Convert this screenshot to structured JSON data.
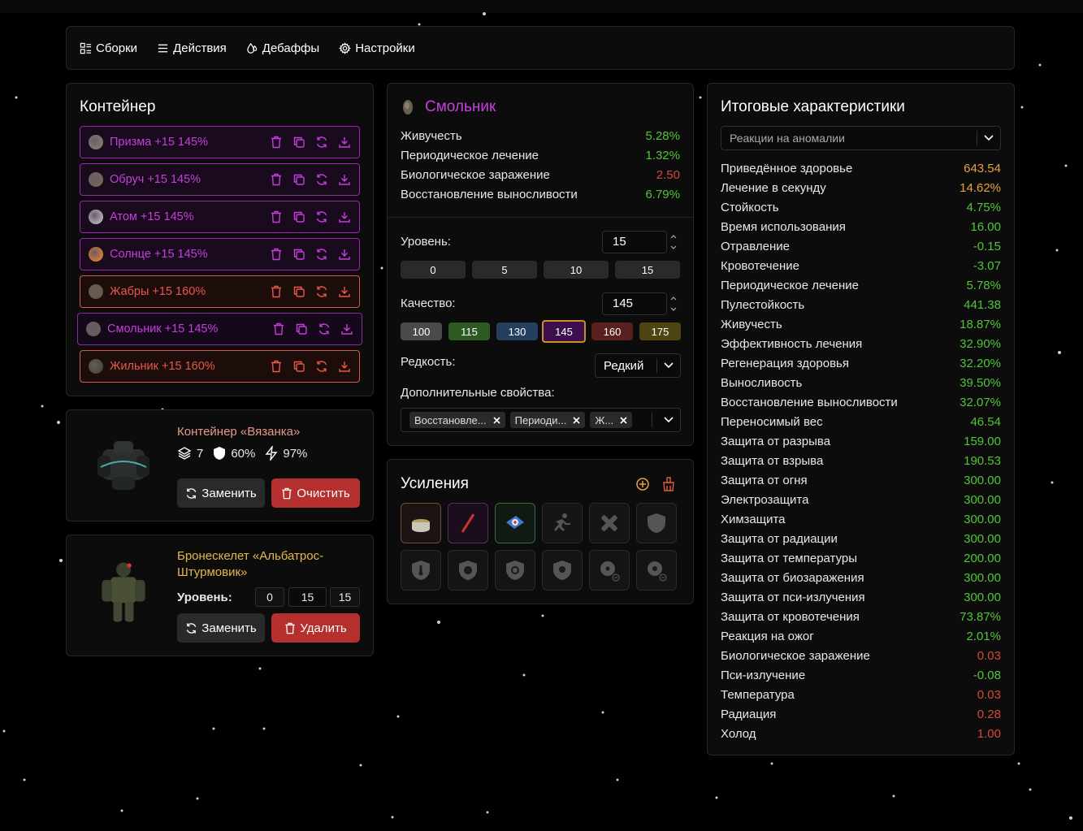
{
  "colors": {
    "green": "#52c43a",
    "orange": "#e8a23c",
    "red": "#d24a3c",
    "purple": "#c43fdc",
    "gold": "#e8b84a"
  },
  "nav": [
    {
      "label": "Сборки",
      "icon": "builds-icon"
    },
    {
      "label": "Действия",
      "icon": "list-icon"
    },
    {
      "label": "Дебаффы",
      "icon": "drops-icon"
    },
    {
      "label": "Настройки",
      "icon": "gear-icon"
    }
  ],
  "container": {
    "title": "Контейнер",
    "artifacts": [
      {
        "name": "Призма +15 145%",
        "tone": "purple",
        "color": "#8a8c6a"
      },
      {
        "name": "Обруч +15 145%",
        "tone": "purple",
        "color": "#7a6a50"
      },
      {
        "name": "Атом +15 145%",
        "tone": "purple",
        "color": "#cfcfcf"
      },
      {
        "name": "Солнце +15 145%",
        "tone": "purple",
        "color": "#ff8a1a"
      },
      {
        "name": "Жабры +15 160%",
        "tone": "red",
        "color": "#6a5440"
      },
      {
        "name": "Смольник +15 145%",
        "tone": "purple",
        "color": "#6a6050",
        "selected": true
      },
      {
        "name": "Жильник +15 160%",
        "tone": "red",
        "color": "#3a4030"
      }
    ]
  },
  "container_card": {
    "title": "Контейнер «Вязанка»",
    "slots": "7",
    "protection": "60%",
    "efficiency": "97%",
    "replace_label": "Заменить",
    "clear_label": "Очистить"
  },
  "armor_card": {
    "title_line1": "Бронескелет «Альбатрос-",
    "title_line2": "Штурмовик»",
    "level_label": "Уровень:",
    "levels": [
      "0",
      "15",
      "15"
    ],
    "replace_label": "Заменить",
    "delete_label": "Удалить"
  },
  "artifact": {
    "name": "Смольник",
    "stats": [
      {
        "label": "Живучесть",
        "value": "5.28%",
        "tone": "g"
      },
      {
        "label": "Периодическое лечение",
        "value": "1.32%",
        "tone": "g"
      },
      {
        "label": "Биологическое заражение",
        "value": "2.50",
        "tone": "r"
      },
      {
        "label": "Восстановление выносливости",
        "value": "6.79%",
        "tone": "g"
      }
    ],
    "level_label": "Уровень:",
    "level_value": "15",
    "level_presets": [
      "0",
      "5",
      "10",
      "15"
    ],
    "quality_label": "Качество:",
    "quality_value": "145",
    "quality_presets": [
      {
        "v": "100",
        "bg": "#4a4a4a"
      },
      {
        "v": "115",
        "bg": "#2d5a23"
      },
      {
        "v": "130",
        "bg": "#24405e"
      },
      {
        "v": "145",
        "bg": "#3e0f4e"
      },
      {
        "v": "160",
        "bg": "#5a1f1f"
      },
      {
        "v": "175",
        "bg": "#4e4414"
      }
    ],
    "rarity_label": "Редкость:",
    "rarity_value": "Редкий",
    "extra_label": "Дополнительные свойства:",
    "extra_chips": [
      "Восстановле...",
      "Периоди...",
      "Ж..."
    ]
  },
  "boosts": {
    "title": "Усиления"
  },
  "totals": {
    "title": "Итоговые характеристики",
    "filter": "Реакции на аномалии",
    "rows": [
      {
        "label": "Приведённое здоровье",
        "value": "643.54",
        "tone": "o"
      },
      {
        "label": "Лечение в секунду",
        "value": "14.62%",
        "tone": "o"
      },
      {
        "label": "Стойкость",
        "value": "4.75%",
        "tone": "g"
      },
      {
        "label": "Время использования",
        "value": "16.00",
        "tone": "g"
      },
      {
        "label": "Отравление",
        "value": "-0.15",
        "tone": "g"
      },
      {
        "label": "Кровотечение",
        "value": "-3.07",
        "tone": "g"
      },
      {
        "label": "Периодическое лечение",
        "value": "5.78%",
        "tone": "g"
      },
      {
        "label": "Пулестойкость",
        "value": "441.38",
        "tone": "g"
      },
      {
        "label": "Живучесть",
        "value": "18.87%",
        "tone": "g"
      },
      {
        "label": "Эффективность лечения",
        "value": "32.90%",
        "tone": "g"
      },
      {
        "label": "Регенерация здоровья",
        "value": "32.20%",
        "tone": "g"
      },
      {
        "label": "Выносливость",
        "value": "39.50%",
        "tone": "g"
      },
      {
        "label": "Восстановление выносливости",
        "value": "32.07%",
        "tone": "g"
      },
      {
        "label": "Переносимый вес",
        "value": "46.54",
        "tone": "g"
      },
      {
        "label": "Защита от разрыва",
        "value": "159.00",
        "tone": "g"
      },
      {
        "label": "Защита от взрыва",
        "value": "190.53",
        "tone": "g"
      },
      {
        "label": "Защита от огня",
        "value": "300.00",
        "tone": "g"
      },
      {
        "label": "Электрозащита",
        "value": "300.00",
        "tone": "g"
      },
      {
        "label": "Химзащита",
        "value": "300.00",
        "tone": "g"
      },
      {
        "label": "Защита от радиации",
        "value": "300.00",
        "tone": "g"
      },
      {
        "label": "Защита от температуры",
        "value": "200.00",
        "tone": "g"
      },
      {
        "label": "Защита от биозаражения",
        "value": "300.00",
        "tone": "g"
      },
      {
        "label": "Защита от пси-излучения",
        "value": "300.00",
        "tone": "g"
      },
      {
        "label": "Защита от кровотечения",
        "value": "73.87%",
        "tone": "g"
      },
      {
        "label": "Реакция на ожог",
        "value": "2.01%",
        "tone": "g"
      },
      {
        "label": "Биологическое заражение",
        "value": "0.03",
        "tone": "r"
      },
      {
        "label": "Пси-излучение",
        "value": "-0.08",
        "tone": "g"
      },
      {
        "label": "Температура",
        "value": "0.03",
        "tone": "r"
      },
      {
        "label": "Радиация",
        "value": "0.28",
        "tone": "r"
      },
      {
        "label": "Холод",
        "value": "1.00",
        "tone": "r"
      }
    ]
  }
}
